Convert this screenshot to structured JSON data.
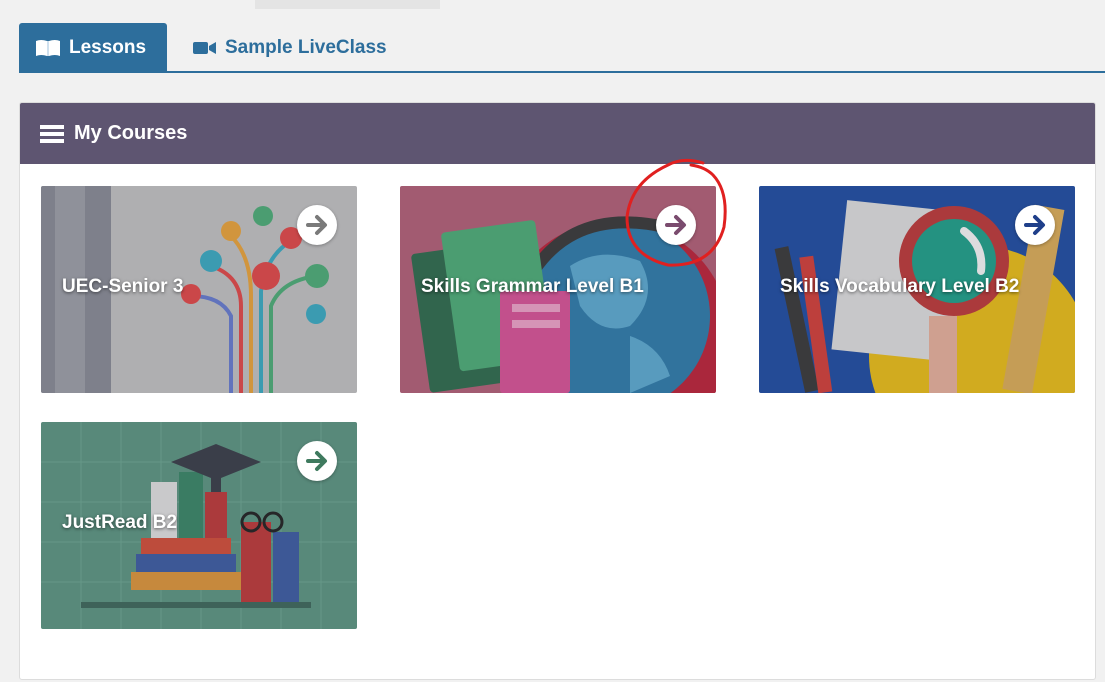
{
  "tabs": [
    {
      "label": "Lessons",
      "icon": "book-icon",
      "active": true
    },
    {
      "label": "Sample LiveClass",
      "icon": "video-camera-icon",
      "active": false
    }
  ],
  "panel": {
    "title": "My Courses",
    "icon": "list-icon"
  },
  "courses": [
    {
      "title": "UEC-Senior 3",
      "arrow_color": "#7a7a7a"
    },
    {
      "title": "Skills Grammar Level B1",
      "arrow_color": "#7a4b6e"
    },
    {
      "title": "Skills Vocabulary Level B2",
      "arrow_color": "#1f3f8a"
    },
    {
      "title": "JustRead B2",
      "arrow_color": "#3e7a5e"
    }
  ],
  "colors": {
    "accent": "#2d6e9c",
    "panel_header": "#5e5571",
    "annotation": "#e02020"
  }
}
